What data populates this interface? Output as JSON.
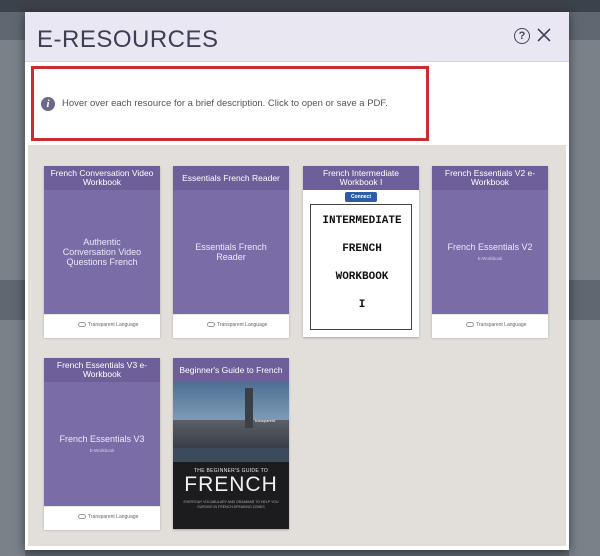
{
  "modal": {
    "title": "E-RESOURCES",
    "help_icon_glyph": "?",
    "close_icon": "close-icon"
  },
  "info": {
    "icon_glyph": "i",
    "text": "Hover over each resource for a brief description. Click to open or save a PDF."
  },
  "resources": [
    {
      "title": "French Conversation Video Workbook",
      "cover_text": "Authentic Conversation Video Questions French",
      "cover_sub": "",
      "brand": "Transparent Language"
    },
    {
      "title": "Essentials French Reader",
      "cover_text": "Essentials French Reader",
      "cover_sub": "",
      "brand": "Transparent Language"
    },
    {
      "title": "French Intermediate Workbook I",
      "logo": "Connect",
      "cover_lines": [
        "INTERMEDIATE",
        "FRENCH",
        "WORKBOOK",
        "I"
      ]
    },
    {
      "title": "French Essentials V2 e-Workbook",
      "cover_text": "French Essentials V2",
      "cover_sub": "E-Workbook",
      "brand": "Transparent Language"
    },
    {
      "title": "French Essentials V3 e-Workbook",
      "cover_text": "French Essentials V3",
      "cover_sub": "E-Workbook",
      "brand": "Transparent Language"
    },
    {
      "title": "Beginner's Guide to French",
      "cover_brand": "transparent",
      "cover_heading": "THE BEGINNER'S GUIDE TO",
      "cover_title": "FRENCH",
      "cover_desc": "EVERYDAY VOCABULARY AND GRAMMAR TO HELP YOU SURVIVE IN FRENCH-SPEAKING ZONES"
    }
  ],
  "colors": {
    "header_bg": "#e9e7f1",
    "accent_purple": "#6e5e99",
    "highlight_red": "#cc2b33"
  }
}
